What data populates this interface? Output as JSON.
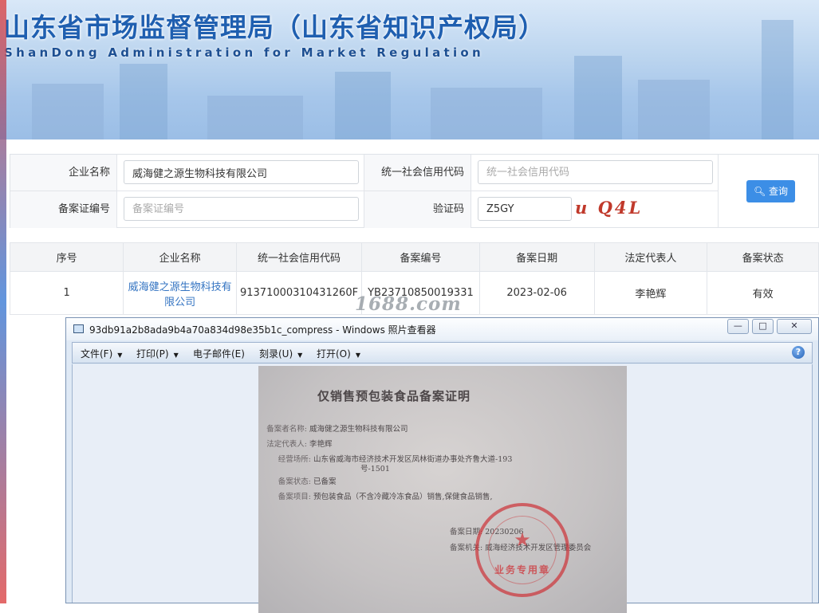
{
  "header": {
    "title_cn": "山东省市场监督管理局（山东省知识产权局）",
    "title_en": "ShanDong Administration for Market Regulation"
  },
  "search": {
    "company_label": "企业名称",
    "company_value": "威海健之源生物科技有限公司",
    "credit_code_label": "统一社会信用代码",
    "credit_code_placeholder": "统一社会信用代码",
    "record_no_label": "备案证编号",
    "record_no_placeholder": "备案证编号",
    "captcha_label": "验证码",
    "captcha_value": "Z5GY",
    "captcha_image_text": "u Q4L",
    "query_button": "查询",
    "query_icon": "search-icon"
  },
  "results": {
    "columns": [
      "序号",
      "企业名称",
      "统一社会信用代码",
      "备案编号",
      "备案日期",
      "法定代表人",
      "备案状态"
    ],
    "rows": [
      {
        "index": "1",
        "company": "威海健之源生物科技有限公司",
        "credit_code": "91371000310431260F",
        "record_no": "YB23710850019331",
        "date": "2023-02-06",
        "legal_rep": "李艳辉",
        "status": "有效"
      }
    ]
  },
  "watermark": "1688.com",
  "viewer": {
    "window_title": "93db91a2b8ada9b4a70a834d98e35b1c_compress - Windows 照片查看器",
    "menu": [
      {
        "label": "文件(F)",
        "has_arrow": true
      },
      {
        "label": "打印(P)",
        "has_arrow": true
      },
      {
        "label": "电子邮件(E)",
        "has_arrow": false
      },
      {
        "label": "刻录(U)",
        "has_arrow": true
      },
      {
        "label": "打开(O)",
        "has_arrow": true
      }
    ],
    "help_icon": "help-icon",
    "photo": {
      "title": "仅销售预包装食品备案证明",
      "fields": [
        {
          "key": "备案者名称:",
          "value": "威海健之源生物科技有限公司"
        },
        {
          "key": "法定代表人:",
          "value": "李艳辉"
        },
        {
          "key": "经营场所:",
          "value": "山东省威海市经济技术开发区凤林街道办事处齐鲁大道-193"
        },
        {
          "key": "",
          "value": "号-1501"
        },
        {
          "key": "备案状态:",
          "value": "已备案"
        },
        {
          "key": "备案项目:",
          "value": "预包装食品（不含冷藏冷冻食品）销售,保健食品销售,"
        }
      ],
      "date_key": "备案日期:",
      "date_value": "20230206",
      "authority_key": "备案机关:",
      "authority_value": "威海经济技术开发区管理委员会",
      "seal_text": "业务专用章"
    }
  }
}
